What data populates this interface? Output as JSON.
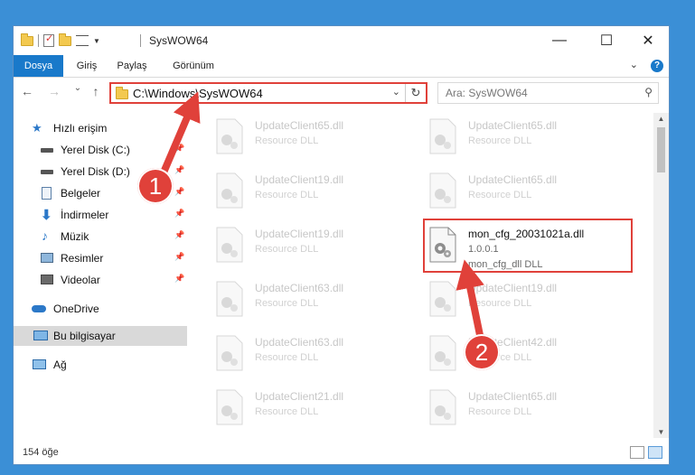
{
  "window": {
    "title": "SysWOW64",
    "controls": {
      "minimize": "—",
      "maximize": "☐",
      "close": "✕"
    }
  },
  "ribbon": {
    "tabs": [
      "Dosya",
      "Giriş",
      "Paylaş",
      "Görünüm"
    ],
    "help": "?"
  },
  "nav": {
    "back": "←",
    "forward": "→",
    "recent": "⌄",
    "up": "↑",
    "address": "C:\\Windows\\SysWOW64",
    "search_placeholder": "Ara: SysWOW64"
  },
  "sidebar": {
    "items": [
      {
        "label": "Hızlı erişim",
        "icon": "star-icon"
      },
      {
        "label": "Yerel Disk (C:)",
        "icon": "drive-icon",
        "pinned": true
      },
      {
        "label": "Yerel Disk (D:)",
        "icon": "drive-icon",
        "pinned": true
      },
      {
        "label": "Belgeler",
        "icon": "documents-icon",
        "pinned": true
      },
      {
        "label": "İndirmeler",
        "icon": "downloads-icon",
        "pinned": true
      },
      {
        "label": "Müzik",
        "icon": "music-icon",
        "pinned": true
      },
      {
        "label": "Resimler",
        "icon": "pictures-icon",
        "pinned": true
      },
      {
        "label": "Videolar",
        "icon": "videos-icon",
        "pinned": true
      },
      {
        "label": "OneDrive",
        "icon": "cloud-icon"
      },
      {
        "label": "Bu bilgisayar",
        "icon": "computer-icon",
        "selected": true
      },
      {
        "label": "Ağ",
        "icon": "network-icon"
      }
    ]
  },
  "files": {
    "left": [
      {
        "name": "UpdateClient65.dll",
        "desc": "Resource DLL"
      },
      {
        "name": "UpdateClient19.dll",
        "desc": "Resource DLL"
      },
      {
        "name": "UpdateClient19.dll",
        "desc": "Resource DLL"
      },
      {
        "name": "UpdateClient63.dll",
        "desc": "Resource DLL"
      },
      {
        "name": "UpdateClient63.dll",
        "desc": "Resource DLL"
      },
      {
        "name": "UpdateClient21.dll",
        "desc": "Resource DLL"
      }
    ],
    "right": [
      {
        "name": "UpdateClient65.dll",
        "desc": "Resource DLL"
      },
      {
        "name": "UpdateClient65.dll",
        "desc": "Resource DLL"
      },
      {
        "name": "mon_cfg_20031021a.dll",
        "desc": "1.0.0.1",
        "desc2": "mon_cfg_dll DLL",
        "highlighted": true
      },
      {
        "name": "UpdateClient19.dll",
        "desc": "Resource DLL"
      },
      {
        "name": "UpdateClient42.dll",
        "desc": "Resource DLL"
      },
      {
        "name": "UpdateClient65.dll",
        "desc": "Resource DLL"
      }
    ]
  },
  "status": {
    "count": "154 öğe"
  },
  "annotations": {
    "step1": "1",
    "step2": "2"
  },
  "colors": {
    "accent": "#1979ca",
    "highlight": "#e0413a",
    "desktop": "#3b8fd6"
  }
}
